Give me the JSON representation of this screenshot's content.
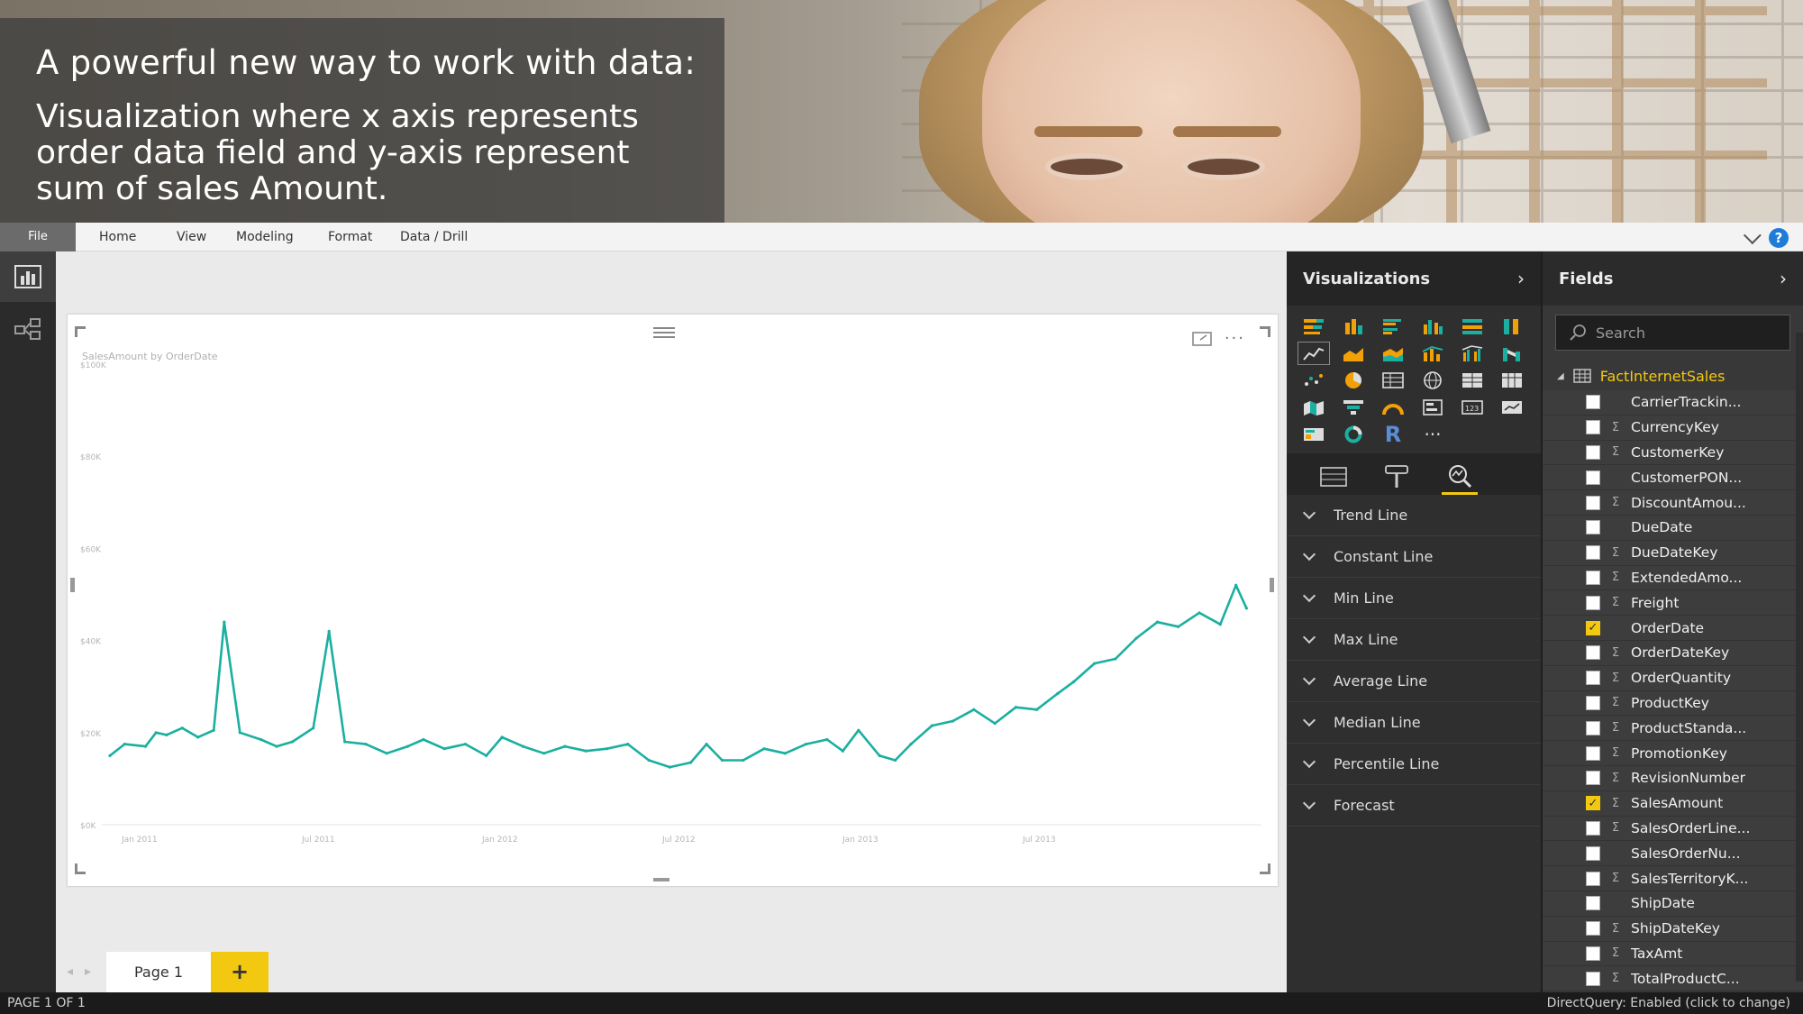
{
  "banner": {
    "headline": "A powerful new way to work with data:",
    "subtext": "Visualization where x axis represents order data field and y-axis represent sum of  sales Amount."
  },
  "ribbon": {
    "file": "File",
    "menus": [
      "Home",
      "View",
      "Modeling",
      "Format",
      "Data / Drill"
    ]
  },
  "canvas": {
    "page_tab": "Page 1",
    "add_page": "+"
  },
  "visualizations_pane": {
    "title": "Visualizations",
    "analytics_items": [
      "Trend Line",
      "Constant Line",
      "Min Line",
      "Max Line",
      "Average Line",
      "Median Line",
      "Percentile Line",
      "Forecast"
    ]
  },
  "fields_pane": {
    "title": "Fields",
    "search_placeholder": "Search",
    "table_name": "FactInternetSales",
    "fields": [
      {
        "name": "CarrierTrackin...",
        "sigma": false,
        "checked": false
      },
      {
        "name": "CurrencyKey",
        "sigma": true,
        "checked": false
      },
      {
        "name": "CustomerKey",
        "sigma": true,
        "checked": false
      },
      {
        "name": "CustomerPON...",
        "sigma": false,
        "checked": false
      },
      {
        "name": "DiscountAmou...",
        "sigma": true,
        "checked": false
      },
      {
        "name": "DueDate",
        "sigma": false,
        "checked": false
      },
      {
        "name": "DueDateKey",
        "sigma": true,
        "checked": false
      },
      {
        "name": "ExtendedAmo...",
        "sigma": true,
        "checked": false
      },
      {
        "name": "Freight",
        "sigma": true,
        "checked": false
      },
      {
        "name": "OrderDate",
        "sigma": false,
        "checked": true
      },
      {
        "name": "OrderDateKey",
        "sigma": true,
        "checked": false
      },
      {
        "name": "OrderQuantity",
        "sigma": true,
        "checked": false
      },
      {
        "name": "ProductKey",
        "sigma": true,
        "checked": false
      },
      {
        "name": "ProductStanda...",
        "sigma": true,
        "checked": false
      },
      {
        "name": "PromotionKey",
        "sigma": true,
        "checked": false
      },
      {
        "name": "RevisionNumber",
        "sigma": true,
        "checked": false
      },
      {
        "name": "SalesAmount",
        "sigma": true,
        "checked": true
      },
      {
        "name": "SalesOrderLine...",
        "sigma": true,
        "checked": false
      },
      {
        "name": "SalesOrderNu...",
        "sigma": false,
        "checked": false
      },
      {
        "name": "SalesTerritoryK...",
        "sigma": true,
        "checked": false
      },
      {
        "name": "ShipDate",
        "sigma": false,
        "checked": false
      },
      {
        "name": "ShipDateKey",
        "sigma": true,
        "checked": false
      },
      {
        "name": "TaxAmt",
        "sigma": true,
        "checked": false
      },
      {
        "name": "TotalProductC...",
        "sigma": true,
        "checked": false
      }
    ]
  },
  "status": {
    "left": "PAGE 1 OF 1",
    "right": "DirectQuery: Enabled (click to change)"
  },
  "colors": {
    "line": "#1aafa0",
    "accent": "#f2c811",
    "help": "#1f7bd8"
  },
  "chart_data": {
    "type": "line",
    "title": "SalesAmount by OrderDate",
    "xlabel": "",
    "ylabel": "",
    "x_ticks": [
      "Jan 2011",
      "Jul 2011",
      "Jan 2012",
      "Jul 2012",
      "Jan 2013",
      "Jul 2013"
    ],
    "y_ticks": [
      "$0K",
      "$20K",
      "$40K",
      "$60K",
      "$80K",
      "$100K"
    ],
    "ylim": [
      0,
      100000
    ],
    "grid": false,
    "series": [
      {
        "values": [
          [
            6,
            15000
          ],
          [
            20,
            17500
          ],
          [
            40,
            17000
          ],
          [
            50,
            20000
          ],
          [
            60,
            19500
          ],
          [
            75,
            21000
          ],
          [
            90,
            19000
          ],
          [
            105,
            20500
          ],
          [
            115,
            44000
          ],
          [
            130,
            20000
          ],
          [
            150,
            18500
          ],
          [
            165,
            17000
          ],
          [
            180,
            18000
          ],
          [
            200,
            21000
          ],
          [
            215,
            42000
          ],
          [
            230,
            18000
          ],
          [
            250,
            17500
          ],
          [
            270,
            15500
          ],
          [
            290,
            17000
          ],
          [
            305,
            18500
          ],
          [
            325,
            16500
          ],
          [
            345,
            17500
          ],
          [
            365,
            15000
          ],
          [
            380,
            19000
          ],
          [
            400,
            17000
          ],
          [
            420,
            15500
          ],
          [
            440,
            17000
          ],
          [
            460,
            16000
          ],
          [
            480,
            16500
          ],
          [
            500,
            17500
          ],
          [
            520,
            14000
          ],
          [
            540,
            12500
          ],
          [
            560,
            13500
          ],
          [
            575,
            17500
          ],
          [
            590,
            14000
          ],
          [
            610,
            14000
          ],
          [
            630,
            16500
          ],
          [
            650,
            15500
          ],
          [
            670,
            17500
          ],
          [
            690,
            18500
          ],
          [
            705,
            16000
          ],
          [
            720,
            20500
          ],
          [
            740,
            15000
          ],
          [
            755,
            14000
          ],
          [
            770,
            17500
          ],
          [
            790,
            21500
          ],
          [
            810,
            22500
          ],
          [
            830,
            25000
          ],
          [
            850,
            22000
          ],
          [
            870,
            25500
          ],
          [
            890,
            25000
          ],
          [
            910,
            28500
          ],
          [
            925,
            31000
          ],
          [
            945,
            35000
          ],
          [
            965,
            36000
          ],
          [
            985,
            40500
          ],
          [
            1005,
            44000
          ],
          [
            1025,
            43000
          ],
          [
            1045,
            46000
          ],
          [
            1065,
            43500
          ],
          [
            1080,
            52000
          ],
          [
            1090,
            47000
          ]
        ]
      }
    ]
  }
}
